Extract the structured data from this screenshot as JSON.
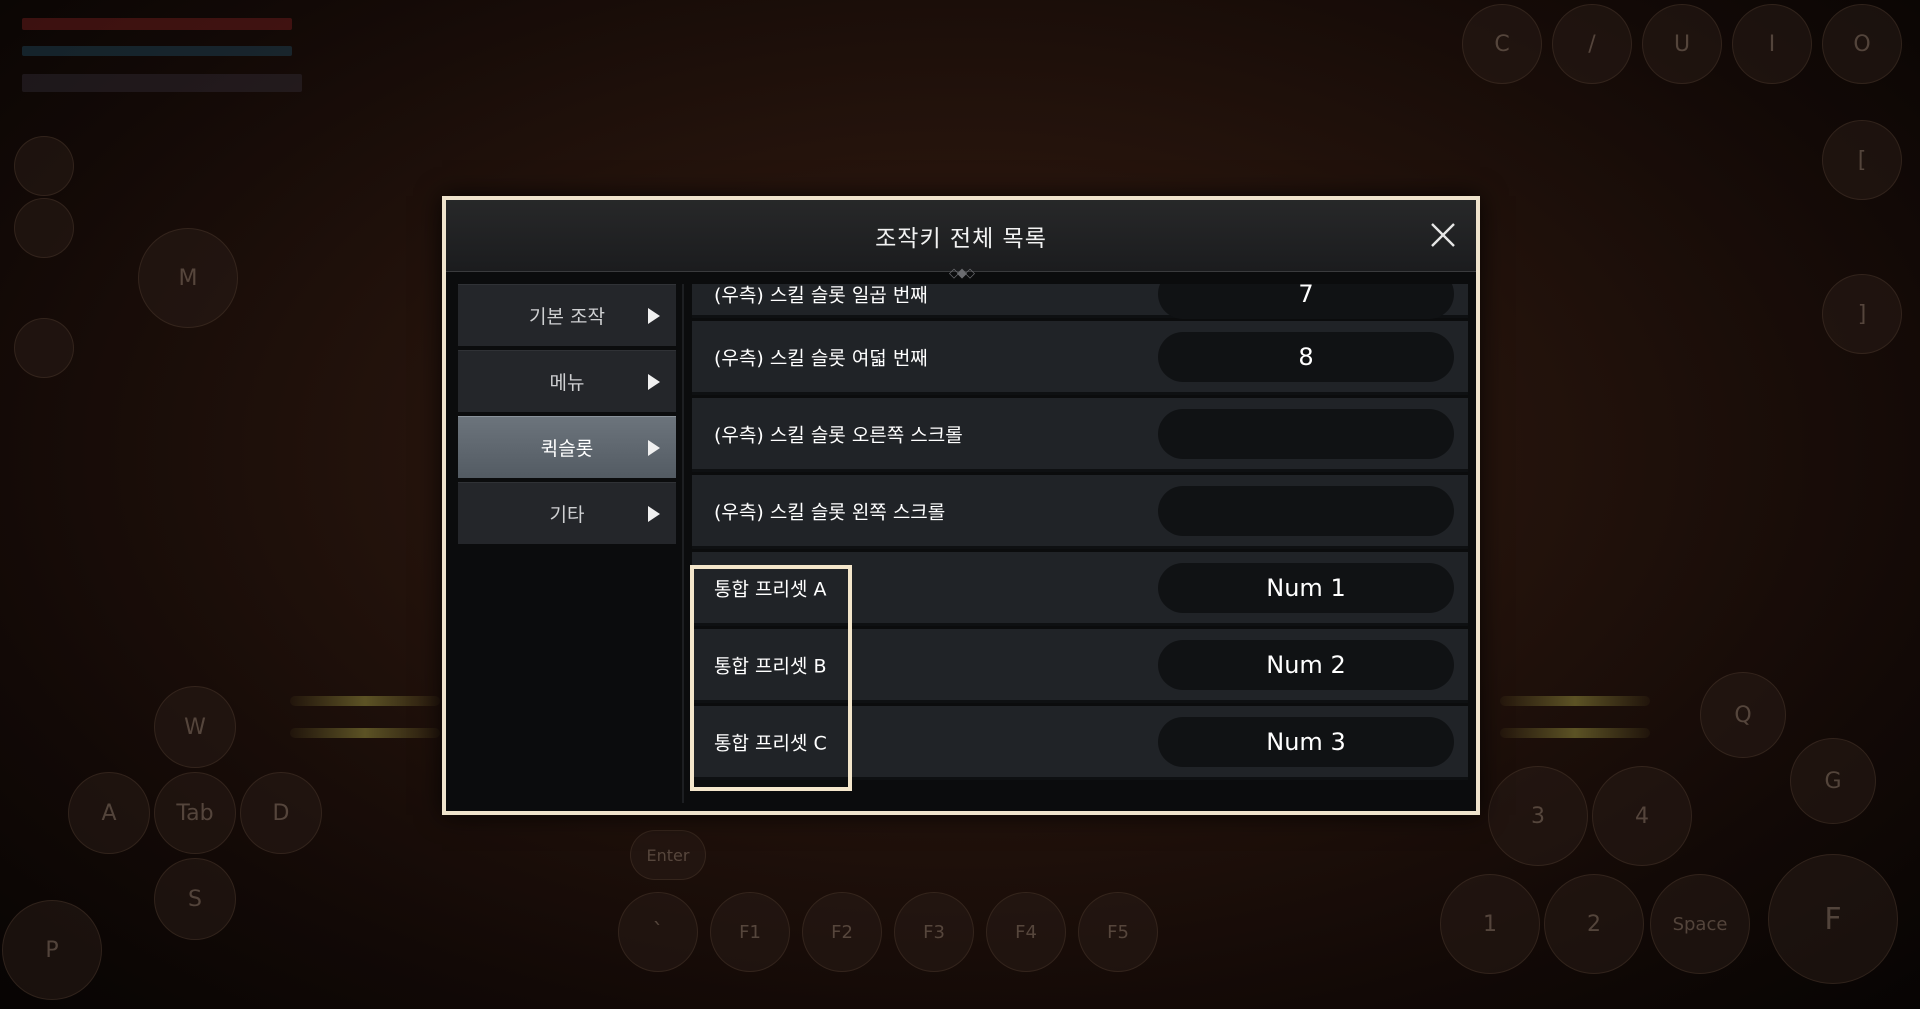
{
  "dialog": {
    "title": "조작키 전체 목록",
    "header_ornament": "◇◆◇"
  },
  "side_nav": {
    "items": [
      {
        "label": "기본 조작",
        "active": false
      },
      {
        "label": "메뉴",
        "active": false
      },
      {
        "label": "퀵슬롯",
        "active": true
      },
      {
        "label": "기타",
        "active": false
      }
    ]
  },
  "keybind_list": {
    "rows": [
      {
        "label": "(우측) 스킬 슬롯 일곱 번째",
        "key": "7"
      },
      {
        "label": "(우측) 스킬 슬롯 여덟 번째",
        "key": "8"
      },
      {
        "label": "(우측) 스킬 슬롯 오른쪽 스크롤",
        "key": ""
      },
      {
        "label": "(우측) 스킬 슬롯 왼쪽 스크롤",
        "key": ""
      },
      {
        "label": "통합 프리셋 A",
        "key": "Num 1"
      },
      {
        "label": "통합 프리셋 B",
        "key": "Num 2"
      },
      {
        "label": "통합 프리셋 C",
        "key": "Num 3"
      }
    ]
  },
  "background_hud": {
    "top_buttons": [
      "C",
      "/",
      "U",
      "I",
      "O"
    ],
    "left_buttons": [
      "M"
    ],
    "bottom_left_buttons": [
      "W",
      "A",
      "Tab",
      "D",
      "S",
      "P",
      "Enter"
    ],
    "bottom_fkeys": [
      "`",
      "F1",
      "F2",
      "F3",
      "F4",
      "F5"
    ],
    "right_buttons": [
      "[",
      "]",
      "Q",
      "G",
      "3",
      "4",
      "1",
      "2",
      "Space",
      "F"
    ]
  },
  "colors": {
    "dialog_border": "#efe3cc",
    "nav_active": "#5f676f",
    "row_bg": "#202327",
    "key_field_bg": "#101214",
    "highlight": "#f4e6cb"
  }
}
